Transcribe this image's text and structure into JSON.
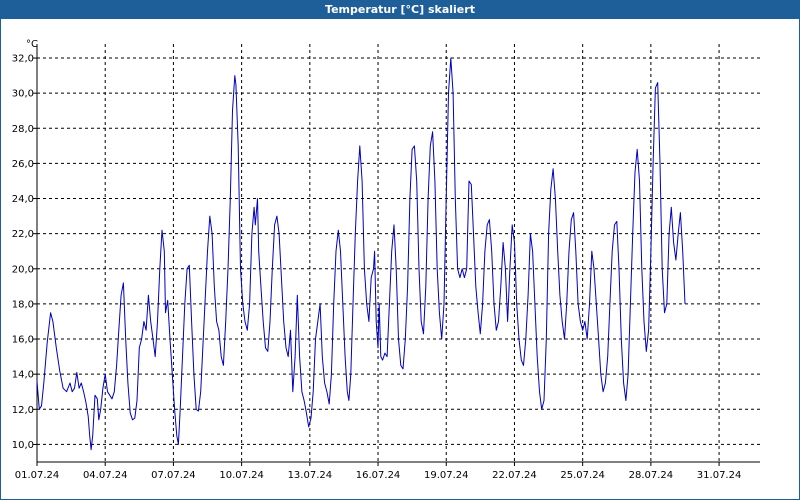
{
  "window": {
    "title": "Temperatur [°C] skaliert"
  },
  "chart_data": {
    "type": "line",
    "title": "Temperatur [°C] skaliert",
    "ylabel": "°C",
    "xlabel": "",
    "xlim": [
      0,
      31.8
    ],
    "ylim": [
      9.0,
      32.8
    ],
    "grid": true,
    "colors": {
      "line": "#0000c0",
      "grid": "#000000",
      "titlebar": "#1f5f99"
    },
    "x_ticks": [
      {
        "x": 0,
        "label": "01.07.24"
      },
      {
        "x": 3,
        "label": "04.07.24"
      },
      {
        "x": 6,
        "label": "07.07.24"
      },
      {
        "x": 9,
        "label": "10.07.24"
      },
      {
        "x": 12,
        "label": "13.07.24"
      },
      {
        "x": 15,
        "label": "16.07.24"
      },
      {
        "x": 18,
        "label": "19.07.24"
      },
      {
        "x": 21,
        "label": "22.07.24"
      },
      {
        "x": 24,
        "label": "25.07.24"
      },
      {
        "x": 27,
        "label": "28.07.24"
      },
      {
        "x": 30,
        "label": "31.07.24"
      }
    ],
    "y_ticks": [
      "10,0",
      "12,0",
      "14,0",
      "16,0",
      "18,0",
      "20,0",
      "22,0",
      "24,0",
      "26,0",
      "28,0",
      "30,0",
      "32,0"
    ],
    "y_tick_values": [
      10,
      12,
      14,
      16,
      18,
      20,
      22,
      24,
      26,
      28,
      30,
      32
    ],
    "series": [
      {
        "points": [
          [
            0.0,
            13.6
          ],
          [
            0.1,
            12.0
          ],
          [
            0.2,
            12.2
          ],
          [
            0.3,
            13.5
          ],
          [
            0.45,
            15.8
          ],
          [
            0.6,
            17.5
          ],
          [
            0.7,
            17.0
          ],
          [
            0.85,
            15.5
          ],
          [
            1.0,
            14.2
          ],
          [
            1.15,
            13.2
          ],
          [
            1.3,
            13.0
          ],
          [
            1.45,
            13.5
          ],
          [
            1.55,
            13.0
          ],
          [
            1.65,
            13.2
          ],
          [
            1.75,
            14.1
          ],
          [
            1.85,
            13.2
          ],
          [
            1.95,
            13.5
          ],
          [
            2.05,
            13.0
          ],
          [
            2.15,
            12.4
          ],
          [
            2.25,
            11.6
          ],
          [
            2.32,
            10.5
          ],
          [
            2.38,
            9.7
          ],
          [
            2.45,
            10.5
          ],
          [
            2.55,
            12.8
          ],
          [
            2.65,
            12.6
          ],
          [
            2.72,
            11.4
          ],
          [
            2.8,
            12.0
          ],
          [
            2.9,
            13.2
          ],
          [
            3.0,
            14.0
          ],
          [
            3.1,
            13.0
          ],
          [
            3.2,
            12.8
          ],
          [
            3.3,
            12.6
          ],
          [
            3.4,
            13.0
          ],
          [
            3.5,
            14.5
          ],
          [
            3.6,
            16.5
          ],
          [
            3.7,
            18.5
          ],
          [
            3.8,
            19.2
          ],
          [
            3.9,
            16.0
          ],
          [
            4.0,
            13.5
          ],
          [
            4.1,
            11.8
          ],
          [
            4.2,
            11.4
          ],
          [
            4.3,
            11.5
          ],
          [
            4.4,
            12.5
          ],
          [
            4.5,
            15.5
          ],
          [
            4.6,
            16.0
          ],
          [
            4.7,
            17.0
          ],
          [
            4.8,
            16.5
          ],
          [
            4.9,
            18.5
          ],
          [
            5.0,
            17.0
          ],
          [
            5.1,
            16.0
          ],
          [
            5.2,
            15.0
          ],
          [
            5.3,
            17.0
          ],
          [
            5.4,
            20.0
          ],
          [
            5.5,
            22.2
          ],
          [
            5.6,
            21.0
          ],
          [
            5.65,
            17.5
          ],
          [
            5.75,
            18.2
          ],
          [
            5.85,
            16.0
          ],
          [
            5.95,
            14.0
          ],
          [
            6.05,
            12.0
          ],
          [
            6.15,
            10.5
          ],
          [
            6.22,
            10.0
          ],
          [
            6.3,
            12.0
          ],
          [
            6.4,
            15.0
          ],
          [
            6.5,
            18.0
          ],
          [
            6.6,
            20.0
          ],
          [
            6.7,
            20.2
          ],
          [
            6.8,
            17.0
          ],
          [
            6.9,
            14.0
          ],
          [
            7.0,
            12.0
          ],
          [
            7.1,
            11.9
          ],
          [
            7.2,
            13.0
          ],
          [
            7.35,
            17.0
          ],
          [
            7.5,
            21.0
          ],
          [
            7.6,
            23.0
          ],
          [
            7.7,
            22.0
          ],
          [
            7.8,
            19.0
          ],
          [
            7.9,
            17.0
          ],
          [
            8.0,
            16.5
          ],
          [
            8.1,
            15.0
          ],
          [
            8.2,
            14.5
          ],
          [
            8.3,
            17.0
          ],
          [
            8.4,
            20.0
          ],
          [
            8.5,
            24.0
          ],
          [
            8.6,
            29.0
          ],
          [
            8.7,
            31.0
          ],
          [
            8.75,
            30.5
          ],
          [
            8.85,
            27.0
          ],
          [
            8.95,
            20.0
          ],
          [
            9.05,
            18.0
          ],
          [
            9.15,
            17.0
          ],
          [
            9.25,
            16.5
          ],
          [
            9.35,
            18.0
          ],
          [
            9.45,
            22.0
          ],
          [
            9.55,
            23.5
          ],
          [
            9.6,
            22.5
          ],
          [
            9.7,
            24.0
          ],
          [
            9.75,
            21.0
          ],
          [
            9.85,
            19.0
          ],
          [
            9.95,
            17.0
          ],
          [
            10.05,
            15.5
          ],
          [
            10.15,
            15.3
          ],
          [
            10.25,
            17.0
          ],
          [
            10.35,
            20.0
          ],
          [
            10.45,
            22.5
          ],
          [
            10.55,
            23.0
          ],
          [
            10.65,
            22.0
          ],
          [
            10.75,
            19.5
          ],
          [
            10.85,
            17.0
          ],
          [
            10.95,
            15.5
          ],
          [
            11.05,
            15.0
          ],
          [
            11.15,
            16.5
          ],
          [
            11.25,
            13.0
          ],
          [
            11.35,
            15.0
          ],
          [
            11.45,
            18.5
          ],
          [
            11.55,
            15.0
          ],
          [
            11.65,
            13.0
          ],
          [
            11.75,
            12.5
          ],
          [
            11.85,
            11.8
          ],
          [
            11.95,
            11.0
          ],
          [
            12.05,
            11.5
          ],
          [
            12.15,
            13.0
          ],
          [
            12.25,
            16.0
          ],
          [
            12.35,
            17.0
          ],
          [
            12.45,
            18.0
          ],
          [
            12.55,
            15.0
          ],
          [
            12.65,
            13.5
          ],
          [
            12.75,
            13.0
          ],
          [
            12.85,
            12.3
          ],
          [
            12.95,
            14.0
          ],
          [
            13.05,
            18.0
          ],
          [
            13.15,
            21.0
          ],
          [
            13.25,
            22.2
          ],
          [
            13.35,
            21.0
          ],
          [
            13.45,
            18.0
          ],
          [
            13.55,
            15.0
          ],
          [
            13.65,
            13.0
          ],
          [
            13.72,
            12.5
          ],
          [
            13.8,
            14.0
          ],
          [
            13.9,
            18.0
          ],
          [
            14.0,
            22.0
          ],
          [
            14.1,
            25.0
          ],
          [
            14.2,
            27.0
          ],
          [
            14.3,
            25.0
          ],
          [
            14.4,
            20.0
          ],
          [
            14.5,
            18.0
          ],
          [
            14.6,
            17.0
          ],
          [
            14.7,
            19.5
          ],
          [
            14.8,
            20.0
          ],
          [
            14.85,
            21.0
          ],
          [
            14.92,
            17.0
          ],
          [
            15.0,
            15.5
          ],
          [
            15.05,
            18.0
          ],
          [
            15.12,
            15.0
          ],
          [
            15.2,
            14.8
          ],
          [
            15.3,
            15.2
          ],
          [
            15.4,
            15.0
          ],
          [
            15.5,
            18.0
          ],
          [
            15.6,
            21.0
          ],
          [
            15.7,
            22.5
          ],
          [
            15.8,
            20.0
          ],
          [
            15.9,
            16.0
          ],
          [
            16.0,
            14.5
          ],
          [
            16.1,
            14.3
          ],
          [
            16.2,
            16.0
          ],
          [
            16.3,
            19.0
          ],
          [
            16.4,
            24.0
          ],
          [
            16.5,
            26.8
          ],
          [
            16.6,
            27.0
          ],
          [
            16.7,
            25.0
          ],
          [
            16.8,
            20.0
          ],
          [
            16.9,
            17.0
          ],
          [
            17.0,
            16.3
          ],
          [
            17.1,
            19.0
          ],
          [
            17.2,
            24.0
          ],
          [
            17.3,
            27.0
          ],
          [
            17.4,
            27.8
          ],
          [
            17.5,
            25.0
          ],
          [
            17.6,
            20.0
          ],
          [
            17.7,
            17.5
          ],
          [
            17.8,
            16.0
          ],
          [
            17.9,
            18.0
          ],
          [
            18.0,
            24.0
          ],
          [
            18.1,
            30.0
          ],
          [
            18.2,
            32.0
          ],
          [
            18.3,
            30.0
          ],
          [
            18.4,
            24.0
          ],
          [
            18.5,
            20.0
          ],
          [
            18.6,
            19.5
          ],
          [
            18.7,
            20.0
          ],
          [
            18.8,
            19.5
          ],
          [
            18.9,
            20.0
          ],
          [
            19.0,
            25.0
          ],
          [
            19.1,
            24.8
          ],
          [
            19.2,
            22.0
          ],
          [
            19.3,
            19.0
          ],
          [
            19.4,
            17.5
          ],
          [
            19.5,
            16.3
          ],
          [
            19.6,
            18.0
          ],
          [
            19.7,
            21.0
          ],
          [
            19.8,
            22.5
          ],
          [
            19.9,
            22.8
          ],
          [
            20.0,
            21.0
          ],
          [
            20.1,
            18.0
          ],
          [
            20.2,
            16.5
          ],
          [
            20.3,
            17.0
          ],
          [
            20.4,
            19.0
          ],
          [
            20.5,
            21.5
          ],
          [
            20.6,
            20.0
          ],
          [
            20.7,
            17.0
          ],
          [
            20.8,
            20.0
          ],
          [
            20.9,
            22.5
          ],
          [
            21.0,
            21.5
          ],
          [
            21.1,
            18.0
          ],
          [
            21.2,
            16.0
          ],
          [
            21.3,
            14.8
          ],
          [
            21.4,
            14.5
          ],
          [
            21.5,
            16.0
          ],
          [
            21.6,
            18.5
          ],
          [
            21.7,
            22.0
          ],
          [
            21.8,
            21.0
          ],
          [
            21.9,
            18.0
          ],
          [
            22.0,
            15.0
          ],
          [
            22.1,
            13.0
          ],
          [
            22.2,
            12.0
          ],
          [
            22.3,
            12.5
          ],
          [
            22.4,
            16.0
          ],
          [
            22.5,
            22.0
          ],
          [
            22.6,
            24.5
          ],
          [
            22.7,
            25.7
          ],
          [
            22.8,
            24.0
          ],
          [
            22.9,
            21.0
          ],
          [
            23.0,
            18.5
          ],
          [
            23.1,
            17.0
          ],
          [
            23.2,
            16.0
          ],
          [
            23.3,
            18.0
          ],
          [
            23.4,
            21.0
          ],
          [
            23.5,
            22.8
          ],
          [
            23.6,
            23.2
          ],
          [
            23.7,
            21.0
          ],
          [
            23.8,
            18.0
          ],
          [
            23.9,
            17.0
          ],
          [
            24.0,
            16.5
          ],
          [
            24.1,
            17.0
          ],
          [
            24.2,
            16.0
          ],
          [
            24.3,
            18.0
          ],
          [
            24.4,
            21.0
          ],
          [
            24.5,
            20.0
          ],
          [
            24.6,
            18.0
          ],
          [
            24.7,
            16.0
          ],
          [
            24.8,
            14.0
          ],
          [
            24.9,
            13.0
          ],
          [
            25.0,
            13.5
          ],
          [
            25.1,
            15.0
          ],
          [
            25.2,
            18.0
          ],
          [
            25.3,
            21.0
          ],
          [
            25.4,
            22.5
          ],
          [
            25.5,
            22.7
          ],
          [
            25.6,
            20.0
          ],
          [
            25.7,
            16.0
          ],
          [
            25.8,
            13.5
          ],
          [
            25.9,
            12.5
          ],
          [
            26.0,
            14.0
          ],
          [
            26.1,
            18.0
          ],
          [
            26.2,
            22.0
          ],
          [
            26.3,
            25.5
          ],
          [
            26.4,
            26.8
          ],
          [
            26.5,
            25.0
          ],
          [
            26.6,
            20.0
          ],
          [
            26.7,
            17.0
          ],
          [
            26.8,
            15.3
          ],
          [
            26.9,
            16.5
          ],
          [
            27.0,
            21.0
          ],
          [
            27.1,
            26.0
          ],
          [
            27.2,
            30.3
          ],
          [
            27.3,
            30.6
          ],
          [
            27.4,
            26.0
          ],
          [
            27.5,
            20.0
          ],
          [
            27.6,
            17.5
          ],
          [
            27.7,
            18.0
          ],
          [
            27.8,
            22.0
          ],
          [
            27.9,
            23.5
          ],
          [
            28.0,
            21.5
          ],
          [
            28.1,
            20.5
          ],
          [
            28.2,
            22.0
          ],
          [
            28.3,
            23.2
          ],
          [
            28.4,
            21.0
          ],
          [
            28.5,
            18.0
          ]
        ]
      }
    ]
  }
}
